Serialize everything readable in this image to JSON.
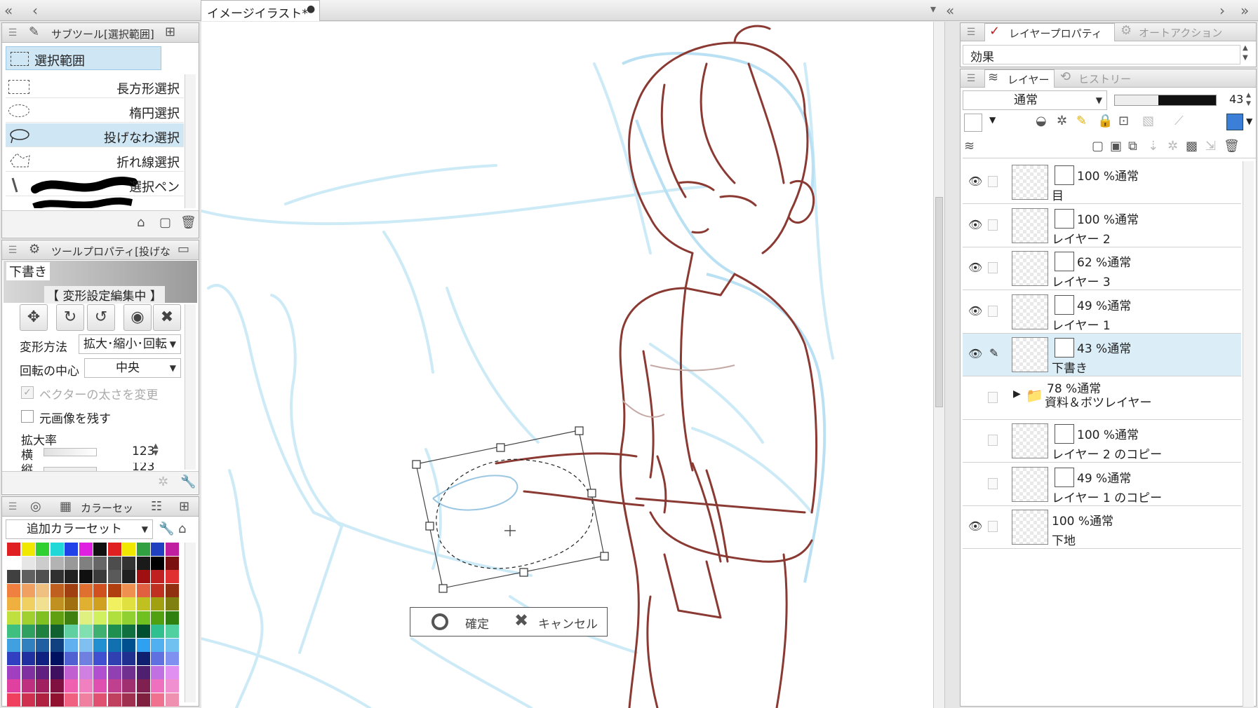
{
  "document": {
    "tab_title": "イメージイラスト*"
  },
  "subtool": {
    "header": "サブツール[選択範囲]",
    "group_label": "選択範囲",
    "items": [
      {
        "label": "長方形選択",
        "icon": "rect-select-icon"
      },
      {
        "label": "楕円選択",
        "icon": "ellipse-select-icon"
      },
      {
        "label": "投げなわ選択",
        "icon": "lasso-select-icon"
      },
      {
        "label": "折れ線選択",
        "icon": "polyline-select-icon"
      },
      {
        "label": "選択ペン",
        "icon": "select-pen-icon"
      }
    ],
    "selected_index": 2
  },
  "tool_property": {
    "header": "ツールプロパティ[投げな",
    "preset_name": "下書き",
    "edit_banner": "【 変形設定編集中 】",
    "transform_method_label": "変形方法",
    "transform_method_value": "拡大･縮小･回転",
    "rotation_center_label": "回転の中心",
    "rotation_center_value": "中央",
    "vector_width_label": "ベクターの太さを変更",
    "keep_original_label": "元画像を残す",
    "scale_label": "拡大率",
    "scale_h_label": "横",
    "scale_h_value": "123",
    "scale_v_label": "縦",
    "scale_v_value": "123"
  },
  "color_set": {
    "header": "カラーセッ",
    "set_name": "追加カラーセット",
    "colors": [
      [
        "#e02020",
        "#f0e800",
        "#30d030",
        "#20d8d8",
        "#2040e8",
        "#e020e0",
        "#111111",
        "#e02020",
        "#f0e800",
        "#30a040",
        "#2040c0",
        "#c020a0"
      ],
      [
        "#ffffff",
        "#e6e6e6",
        "#cccccc",
        "#b3b3b3",
        "#999999",
        "#808080",
        "#666666",
        "#4d4d4d",
        "#333333",
        "#1a1a1a",
        "#000000",
        "#7a1010"
      ],
      [
        "#404040",
        "#606060",
        "#505050",
        "#303030",
        "#202020",
        "#101010",
        "#3a3a3a",
        "#5a5a5a",
        "#202020",
        "#a01010",
        "#c02020",
        "#e03030"
      ],
      [
        "#f08040",
        "#f0a060",
        "#f0c080",
        "#c06020",
        "#a04010",
        "#e07030",
        "#d05020",
        "#b04010",
        "#f09050",
        "#e06040",
        "#c03020",
        "#903010"
      ],
      [
        "#f0b040",
        "#f0d060",
        "#f0e090",
        "#c09020",
        "#a07010",
        "#e0b030",
        "#d0a020",
        "#f0f060",
        "#e0e040",
        "#c0c020",
        "#a0a010",
        "#808010"
      ],
      [
        "#c0e040",
        "#a0d030",
        "#80c020",
        "#60a010",
        "#408010",
        "#e0f080",
        "#d0f060",
        "#b0e040",
        "#90d030",
        "#70c020",
        "#50a010",
        "#308010"
      ],
      [
        "#40c080",
        "#30a060",
        "#208040",
        "#106030",
        "#60d0a0",
        "#80e0b0",
        "#40b070",
        "#209050",
        "#107040",
        "#005030",
        "#30c090",
        "#50d0a0"
      ],
      [
        "#40a0e0",
        "#3080c0",
        "#2060a0",
        "#104080",
        "#60b0f0",
        "#80c0f0",
        "#2090d0",
        "#1070b0",
        "#005090",
        "#30a0f0",
        "#50b0f0",
        "#70c0f0"
      ],
      [
        "#3040c0",
        "#2030a0",
        "#102080",
        "#001060",
        "#5060d0",
        "#7080e0",
        "#4050d0",
        "#3040b0",
        "#203090",
        "#102070",
        "#6070e0",
        "#8090f0"
      ],
      [
        "#a040c0",
        "#8030a0",
        "#602080",
        "#401060",
        "#c060d0",
        "#d080e0",
        "#b050d0",
        "#9040b0",
        "#703090",
        "#502070",
        "#c070e0",
        "#e090f0"
      ],
      [
        "#e040a0",
        "#c03080",
        "#a02060",
        "#801040",
        "#f060b0",
        "#f080c0",
        "#e050b0",
        "#c04090",
        "#a03070",
        "#802050",
        "#f070c0",
        "#f090d0"
      ],
      [
        "#f04060",
        "#d03050",
        "#b02040",
        "#901030",
        "#f06080",
        "#f080a0",
        "#e05070",
        "#c04060",
        "#a03050",
        "#802040",
        "#f07090",
        "#f090b0"
      ]
    ]
  },
  "transform": {
    "confirm_label": "確定",
    "cancel_label": "キャンセル"
  },
  "layer_property": {
    "tab_active": "レイヤープロパティ",
    "tab_inactive": "オートアクション",
    "effect_label": "効果"
  },
  "layer_panel": {
    "tab_active": "レイヤー",
    "tab_inactive": "ヒストリー",
    "blend_mode": "通常",
    "opacity": "43",
    "layers": [
      {
        "mode": "100 %通常",
        "name": "目",
        "visible": true,
        "selected": false
      },
      {
        "mode": "100 %通常",
        "name": "レイヤー 2",
        "visible": true,
        "selected": false
      },
      {
        "mode": "62 %通常",
        "name": "レイヤー 3",
        "visible": true,
        "selected": false
      },
      {
        "mode": "49 %通常",
        "name": "レイヤー 1",
        "visible": true,
        "selected": false
      },
      {
        "mode": "43 %通常",
        "name": "下書き",
        "visible": true,
        "selected": true
      },
      {
        "mode": "78 %通常",
        "name": "資料＆ボツレイヤー",
        "visible": false,
        "selected": false
      },
      {
        "mode": "100 %通常",
        "name": "レイヤー 2 のコピー",
        "visible": false,
        "selected": false
      },
      {
        "mode": "49 %通常",
        "name": "レイヤー 1 のコピー",
        "visible": false,
        "selected": false
      },
      {
        "mode": "100 %通常",
        "name": "下地",
        "visible": true,
        "selected": false
      }
    ]
  }
}
